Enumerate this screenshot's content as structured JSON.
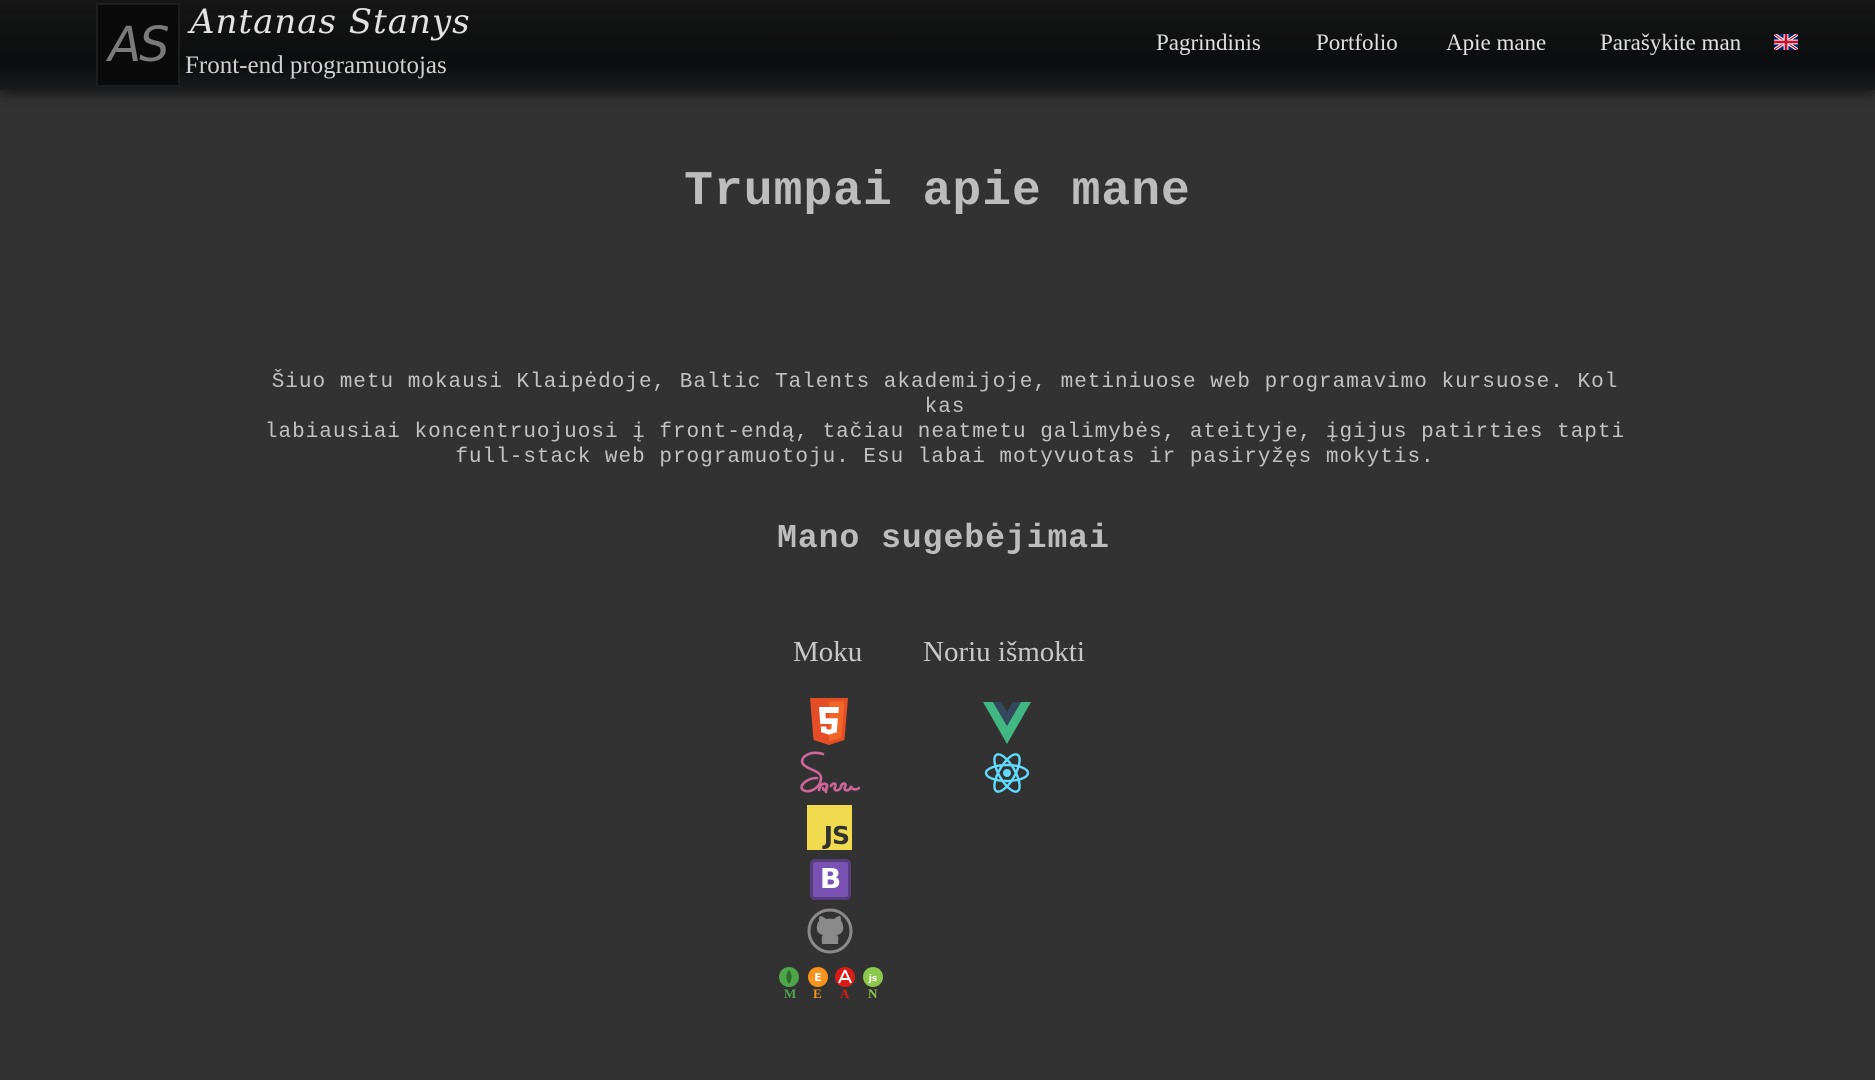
{
  "header": {
    "logo_initials": "AS",
    "brand_name": "Antanas Stanys",
    "brand_subtitle": "Front-end programuotojas",
    "nav": [
      {
        "label": "Pagrindinis"
      },
      {
        "label": "Portfolio"
      },
      {
        "label": "Apie mane"
      },
      {
        "label": "Parašykite man"
      }
    ],
    "language_icon": "uk-flag-icon"
  },
  "main": {
    "title": "Trumpai apie mane",
    "intro_lines": [
      "Šiuo metu mokausi Klaipėdoje, Baltic Talents akademijoje, metiniuose web programavimo kursuose. Kol kas",
      "labiausiai koncentruojuosi į front-endą, tačiau neatmetu galimybės, ateityje, įgijus patirties tapti",
      "full-stack web programuotoju. Esu labai motyvuotas ir pasiryžęs mokytis."
    ],
    "skills_title": "Mano sugebėjimai",
    "known": {
      "heading": "Moku",
      "icons": [
        "html5-icon",
        "sass-icon",
        "javascript-icon",
        "bootstrap-icon",
        "github-icon",
        "mean-stack-icon"
      ],
      "js_label": "JS",
      "bootstrap_label": "B",
      "mean_letters": [
        "M",
        "E",
        "A",
        "N"
      ]
    },
    "wanted": {
      "heading": "Noriu išmokti",
      "icons": [
        "vue-icon",
        "react-icon"
      ]
    }
  },
  "colors": {
    "background": "#323232",
    "header": "#0e0f10",
    "html5": "#e44d26",
    "sass": "#cd6799",
    "javascript": "#f0db4f",
    "bootstrap": "#563d7c",
    "vue": "#41b883",
    "react": "#61dafb"
  }
}
